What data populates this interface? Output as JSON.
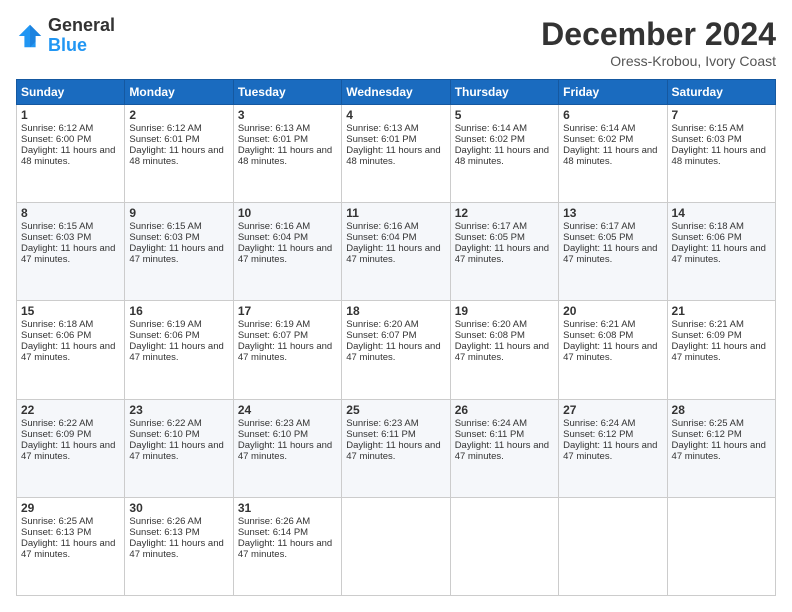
{
  "logo": {
    "line1": "General",
    "line2": "Blue"
  },
  "title": "December 2024",
  "subtitle": "Oress-Krobou, Ivory Coast",
  "days": [
    "Sunday",
    "Monday",
    "Tuesday",
    "Wednesday",
    "Thursday",
    "Friday",
    "Saturday"
  ],
  "weeks": [
    [
      {
        "day": "1",
        "sunrise": "6:12 AM",
        "sunset": "6:00 PM",
        "daylight": "11 hours and 48 minutes."
      },
      {
        "day": "2",
        "sunrise": "6:12 AM",
        "sunset": "6:01 PM",
        "daylight": "11 hours and 48 minutes."
      },
      {
        "day": "3",
        "sunrise": "6:13 AM",
        "sunset": "6:01 PM",
        "daylight": "11 hours and 48 minutes."
      },
      {
        "day": "4",
        "sunrise": "6:13 AM",
        "sunset": "6:01 PM",
        "daylight": "11 hours and 48 minutes."
      },
      {
        "day": "5",
        "sunrise": "6:14 AM",
        "sunset": "6:02 PM",
        "daylight": "11 hours and 48 minutes."
      },
      {
        "day": "6",
        "sunrise": "6:14 AM",
        "sunset": "6:02 PM",
        "daylight": "11 hours and 48 minutes."
      },
      {
        "day": "7",
        "sunrise": "6:15 AM",
        "sunset": "6:03 PM",
        "daylight": "11 hours and 48 minutes."
      }
    ],
    [
      {
        "day": "8",
        "sunrise": "6:15 AM",
        "sunset": "6:03 PM",
        "daylight": "11 hours and 47 minutes."
      },
      {
        "day": "9",
        "sunrise": "6:15 AM",
        "sunset": "6:03 PM",
        "daylight": "11 hours and 47 minutes."
      },
      {
        "day": "10",
        "sunrise": "6:16 AM",
        "sunset": "6:04 PM",
        "daylight": "11 hours and 47 minutes."
      },
      {
        "day": "11",
        "sunrise": "6:16 AM",
        "sunset": "6:04 PM",
        "daylight": "11 hours and 47 minutes."
      },
      {
        "day": "12",
        "sunrise": "6:17 AM",
        "sunset": "6:05 PM",
        "daylight": "11 hours and 47 minutes."
      },
      {
        "day": "13",
        "sunrise": "6:17 AM",
        "sunset": "6:05 PM",
        "daylight": "11 hours and 47 minutes."
      },
      {
        "day": "14",
        "sunrise": "6:18 AM",
        "sunset": "6:06 PM",
        "daylight": "11 hours and 47 minutes."
      }
    ],
    [
      {
        "day": "15",
        "sunrise": "6:18 AM",
        "sunset": "6:06 PM",
        "daylight": "11 hours and 47 minutes."
      },
      {
        "day": "16",
        "sunrise": "6:19 AM",
        "sunset": "6:06 PM",
        "daylight": "11 hours and 47 minutes."
      },
      {
        "day": "17",
        "sunrise": "6:19 AM",
        "sunset": "6:07 PM",
        "daylight": "11 hours and 47 minutes."
      },
      {
        "day": "18",
        "sunrise": "6:20 AM",
        "sunset": "6:07 PM",
        "daylight": "11 hours and 47 minutes."
      },
      {
        "day": "19",
        "sunrise": "6:20 AM",
        "sunset": "6:08 PM",
        "daylight": "11 hours and 47 minutes."
      },
      {
        "day": "20",
        "sunrise": "6:21 AM",
        "sunset": "6:08 PM",
        "daylight": "11 hours and 47 minutes."
      },
      {
        "day": "21",
        "sunrise": "6:21 AM",
        "sunset": "6:09 PM",
        "daylight": "11 hours and 47 minutes."
      }
    ],
    [
      {
        "day": "22",
        "sunrise": "6:22 AM",
        "sunset": "6:09 PM",
        "daylight": "11 hours and 47 minutes."
      },
      {
        "day": "23",
        "sunrise": "6:22 AM",
        "sunset": "6:10 PM",
        "daylight": "11 hours and 47 minutes."
      },
      {
        "day": "24",
        "sunrise": "6:23 AM",
        "sunset": "6:10 PM",
        "daylight": "11 hours and 47 minutes."
      },
      {
        "day": "25",
        "sunrise": "6:23 AM",
        "sunset": "6:11 PM",
        "daylight": "11 hours and 47 minutes."
      },
      {
        "day": "26",
        "sunrise": "6:24 AM",
        "sunset": "6:11 PM",
        "daylight": "11 hours and 47 minutes."
      },
      {
        "day": "27",
        "sunrise": "6:24 AM",
        "sunset": "6:12 PM",
        "daylight": "11 hours and 47 minutes."
      },
      {
        "day": "28",
        "sunrise": "6:25 AM",
        "sunset": "6:12 PM",
        "daylight": "11 hours and 47 minutes."
      }
    ],
    [
      {
        "day": "29",
        "sunrise": "6:25 AM",
        "sunset": "6:13 PM",
        "daylight": "11 hours and 47 minutes."
      },
      {
        "day": "30",
        "sunrise": "6:26 AM",
        "sunset": "6:13 PM",
        "daylight": "11 hours and 47 minutes."
      },
      {
        "day": "31",
        "sunrise": "6:26 AM",
        "sunset": "6:14 PM",
        "daylight": "11 hours and 47 minutes."
      },
      null,
      null,
      null,
      null
    ]
  ]
}
